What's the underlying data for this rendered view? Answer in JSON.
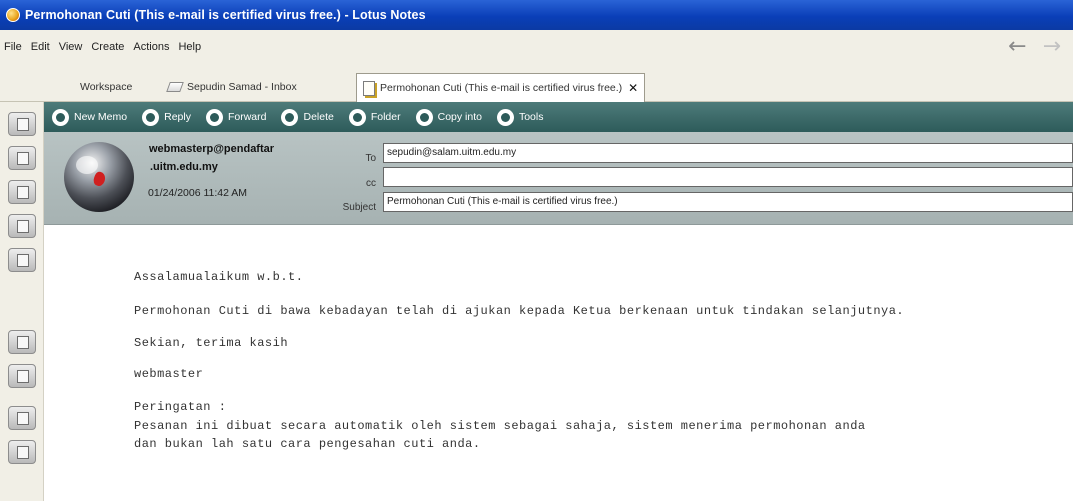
{
  "window": {
    "title": "Permohonan Cuti  (This e-mail is certified virus free.) - Lotus Notes"
  },
  "menu": {
    "items": [
      "File",
      "Edit",
      "View",
      "Create",
      "Actions",
      "Help"
    ]
  },
  "tabs": [
    {
      "label": "Workspace"
    },
    {
      "label": "Sepudin Samad - Inbox"
    },
    {
      "label": "Permohonan Cuti (This e-mail is certified virus free.)",
      "close": "✕"
    }
  ],
  "toolbar": {
    "actions": [
      {
        "label": "New Memo"
      },
      {
        "label": "Reply"
      },
      {
        "label": "Forward"
      },
      {
        "label": "Delete"
      },
      {
        "label": "Folder"
      },
      {
        "label": "Copy into"
      },
      {
        "label": "Tools"
      }
    ]
  },
  "header": {
    "sender_line1": "webmasterp@pendaftar",
    "sender_line2": ".uitm.edu.my",
    "date": "01/24/2006 11:42 AM",
    "to_label": "To",
    "cc_label": "cc",
    "subject_label": "Subject",
    "to_value": "sepudin@salam.uitm.edu.my",
    "cc_value": "",
    "subject_value": "Permohonan Cuti (This e-mail is certified virus free.)"
  },
  "body": {
    "line1": "Assalamualaikum w.b.t.",
    "line2": "Permohonan Cuti di bawa kebadayan telah di ajukan kepada Ketua berkenaan untuk tindakan selanjutnya.",
    "line3": "Sekian, terima kasih",
    "line4": "webmaster",
    "line5": "Peringatan :",
    "line6": "Pesanan ini dibuat secara automatik oleh sistem sebagai sahaja, sistem menerima permohonan anda",
    "line7": "dan bukan lah satu cara pengesahan cuti anda."
  },
  "colors": {
    "titlebar": "#0a3fb8",
    "actionbar": "#2d5b5a",
    "header_bg": "#b8c3c3",
    "chrome_bg": "#f1efe6"
  },
  "icons": {
    "back": "back-arrow-icon",
    "forward": "forward-arrow-icon",
    "sender_avatar": "globe-avatar"
  }
}
